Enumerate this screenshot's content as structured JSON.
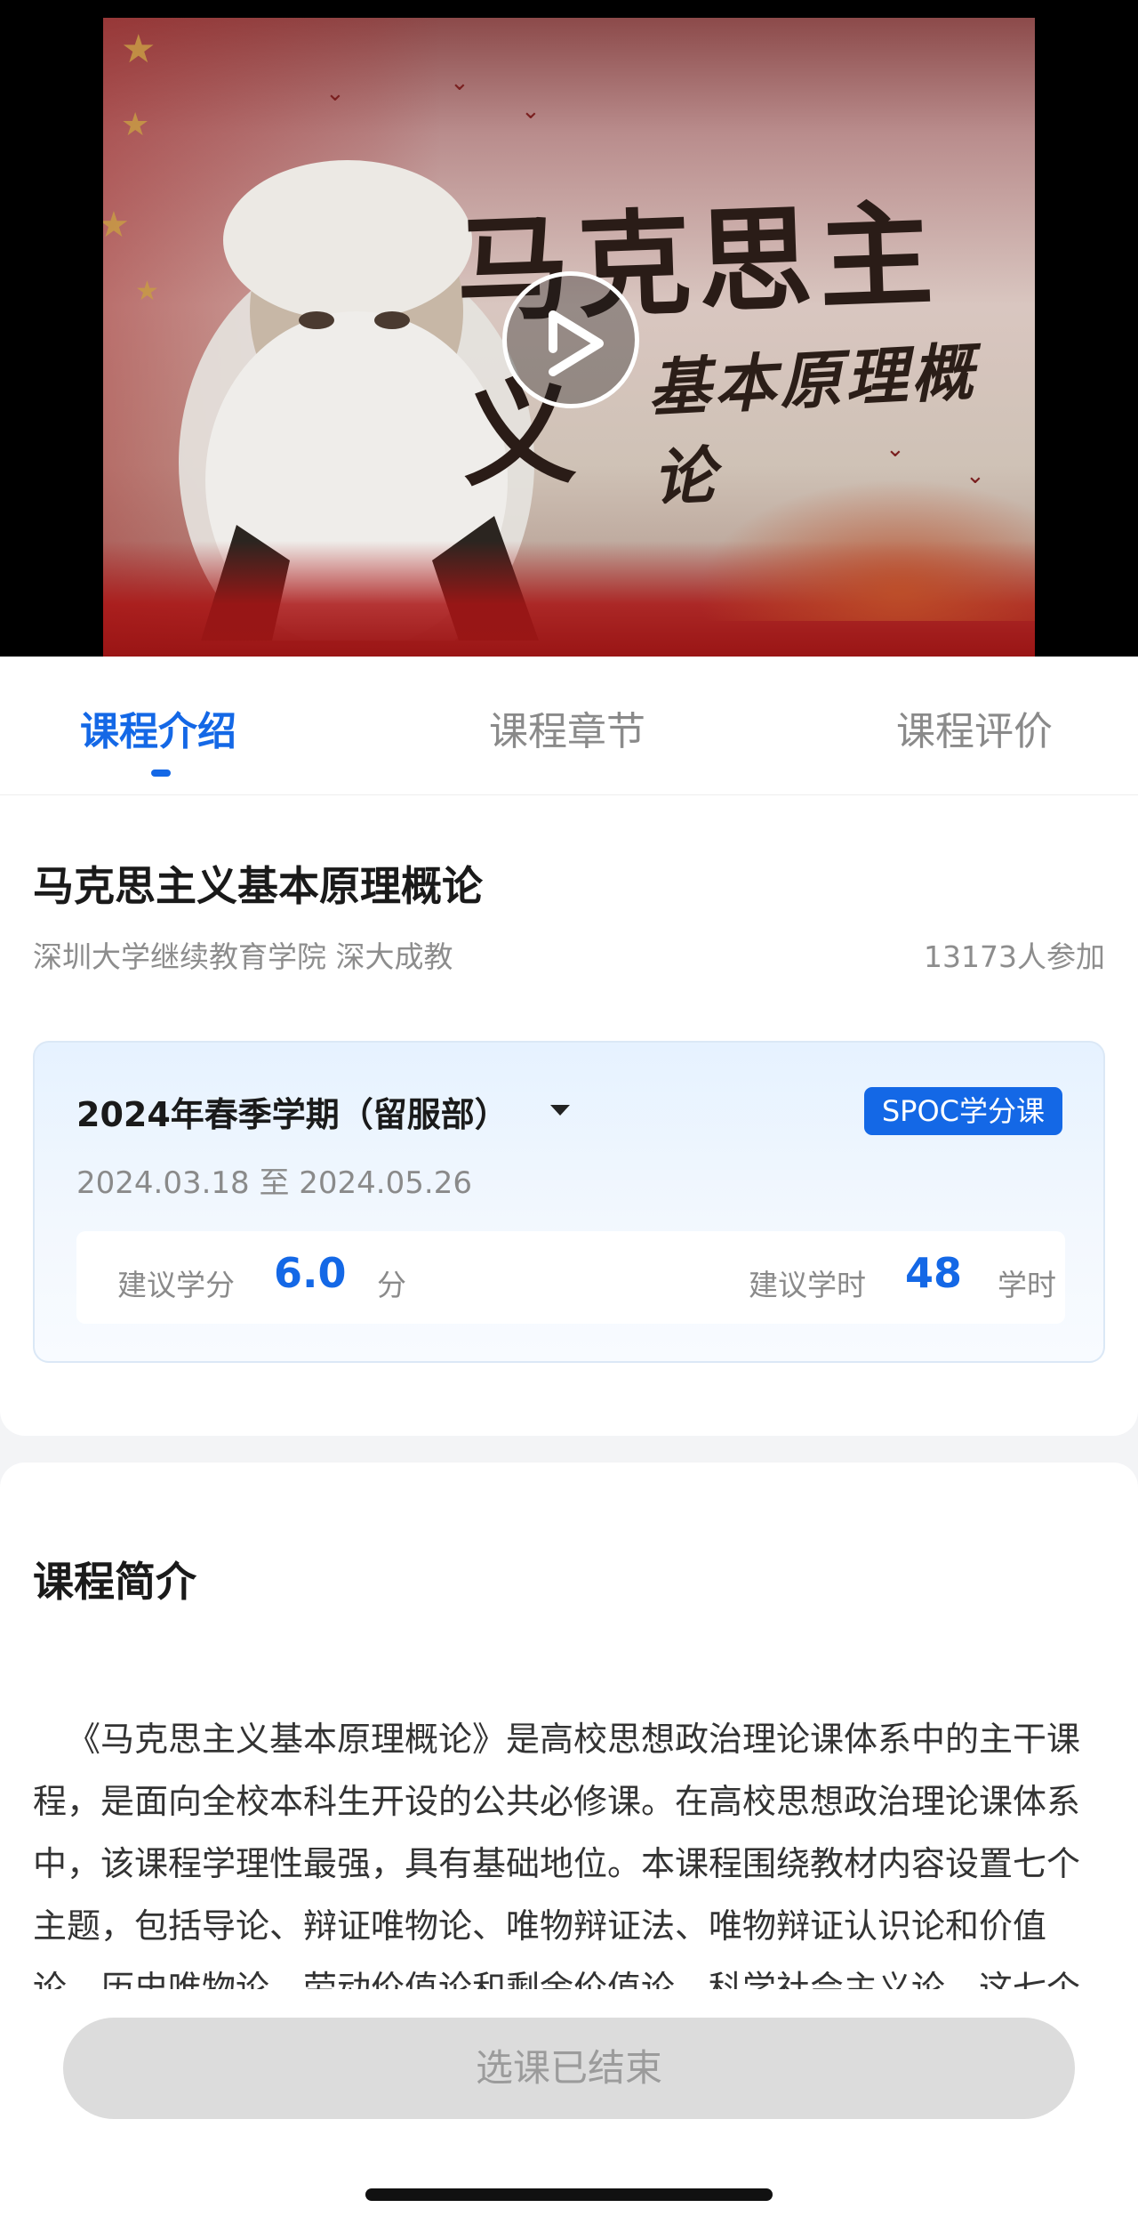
{
  "video": {
    "title_text": "马克思主义",
    "subtitle_text": "基本原理概论",
    "play_icon": "play-icon"
  },
  "tabs": [
    {
      "label": "课程介绍",
      "active": true
    },
    {
      "label": "课程章节",
      "active": false
    },
    {
      "label": "课程评价",
      "active": false
    }
  ],
  "course": {
    "title": "马克思主义基本原理概论",
    "organization": "深圳大学继续教育学院 深大成教",
    "participants": "13173人参加"
  },
  "term": {
    "name": "2024年春季学期（留服部）",
    "badge": "SPOC学分课",
    "dates": "2024.03.18 至 2024.05.26",
    "credit_label": "建议学分",
    "credit_value": "6.0",
    "credit_unit": "分",
    "hours_label": "建议学时",
    "hours_value": "48",
    "hours_unit": "学时"
  },
  "intro": {
    "heading": "课程简介",
    "text": "《马克思主义基本原理概论》是高校思想政治理论课体系中的主干课程，是面向全校本科生开设的公共必修课。在高校思想政治理论课体系中，该课程学理性最强，具有基础地位。本课程围绕教材内容设置七个主题，包括导论、辩证唯物论、唯物辩证法、唯物辩证认识论和价值论、历史唯物论、劳动价值论和剩余价值论、科学社会主义论。这七个主题既紧扣教材，又凸显时代发展特点，既根据新时代学"
  },
  "footer": {
    "enroll_label": "选课已结束"
  },
  "colors": {
    "accent": "#1468e6",
    "disabled_button": "#dcdcdc",
    "muted_text": "#8a8a8a"
  }
}
